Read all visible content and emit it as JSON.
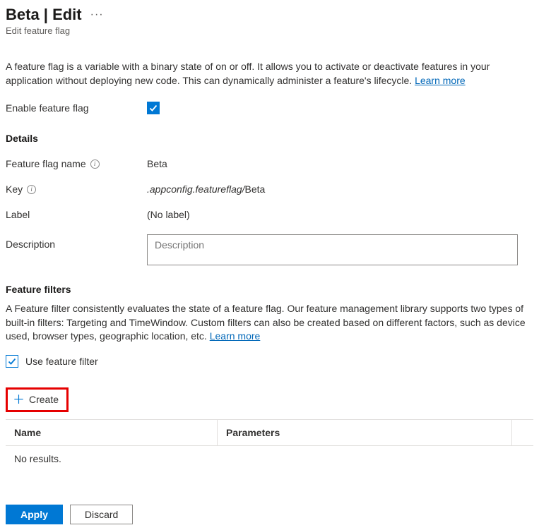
{
  "header": {
    "title": "Beta | Edit",
    "subtitle": "Edit feature flag"
  },
  "intro": {
    "text": "A feature flag is a variable with a binary state of on or off. It allows you to activate or deactivate features in your application without deploying new code. This can dynamically administer a feature's lifecycle. ",
    "learn_more": "Learn more"
  },
  "enable": {
    "label": "Enable feature flag",
    "checked": true
  },
  "details": {
    "heading": "Details",
    "name_label": "Feature flag name",
    "name_value": "Beta",
    "key_label": "Key",
    "key_prefix": ".appconfig.featureflag/",
    "key_value": "Beta",
    "label_label": "Label",
    "label_value": "(No label)",
    "description_label": "Description",
    "description_placeholder": "Description",
    "description_value": ""
  },
  "filters": {
    "heading": "Feature filters",
    "text": "A Feature filter consistently evaluates the state of a feature flag. Our feature management library supports two types of built-in filters: Targeting and TimeWindow. Custom filters can also be created based on different factors, such as device used, browser types, geographic location, etc. ",
    "learn_more": "Learn more",
    "use_filter_label": "Use feature filter",
    "use_filter_checked": true,
    "create_label": "Create",
    "table": {
      "col_name": "Name",
      "col_params": "Parameters",
      "empty": "No results."
    }
  },
  "footer": {
    "apply": "Apply",
    "discard": "Discard"
  }
}
